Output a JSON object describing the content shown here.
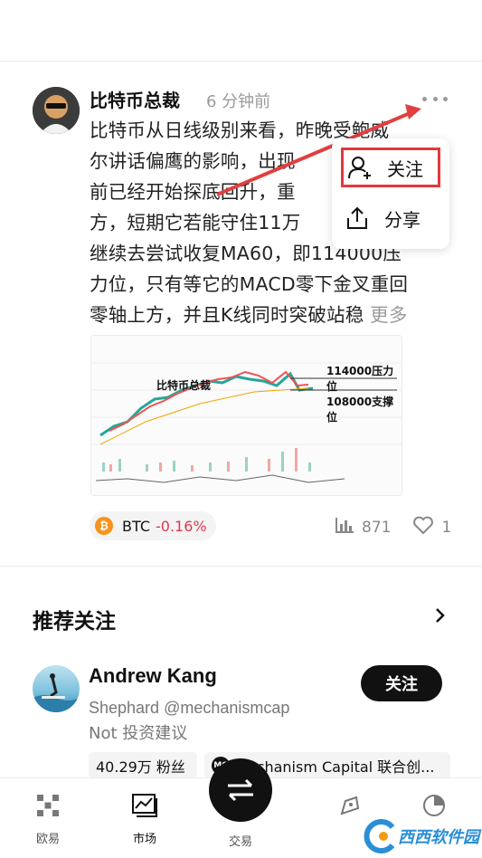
{
  "post": {
    "author": "比特币总裁",
    "time": "6 分钟前",
    "body_lines": [
      "比特币从日线级别来看，昨晚受鲍威",
      "尔讲话偏鹰的影响，出现",
      "前已经开始探底回升，重",
      "方，短期它若能守住11万",
      "继续去尝试收复MA60，即114000压",
      "力位，只有等它的MACD零下金叉重回",
      "零轴上方，并且K线同时突破站稳"
    ],
    "more": "更多",
    "chart_labels": {
      "watermark": "比特币总裁",
      "resistance": "114000压力位",
      "support": "108000支撑位"
    },
    "tag": {
      "coin": "BTC",
      "change": "-0.16%"
    },
    "stats": {
      "views": "871",
      "likes": "1"
    }
  },
  "popup": {
    "follow": "关注",
    "share": "分享"
  },
  "recommend": {
    "title": "推荐关注",
    "user": {
      "name": "Andrew Kang",
      "handle": "Shephard @mechanismcap",
      "bio": "Not 投资建议",
      "follow": "关注",
      "fans": "40.29万 粉丝",
      "company": "Mechanism Capital 联合创...",
      "company_badge": "MC"
    }
  },
  "nav": {
    "items": [
      {
        "label": "欧易"
      },
      {
        "label": "市场"
      },
      {
        "label": "交易"
      },
      {
        "label": ""
      },
      {
        "label": ""
      }
    ]
  },
  "watermark": {
    "text": "西西软件园"
  },
  "colors": {
    "negative": "#e0384f",
    "highlight": "#e0393e",
    "btc": "#f7931a"
  }
}
